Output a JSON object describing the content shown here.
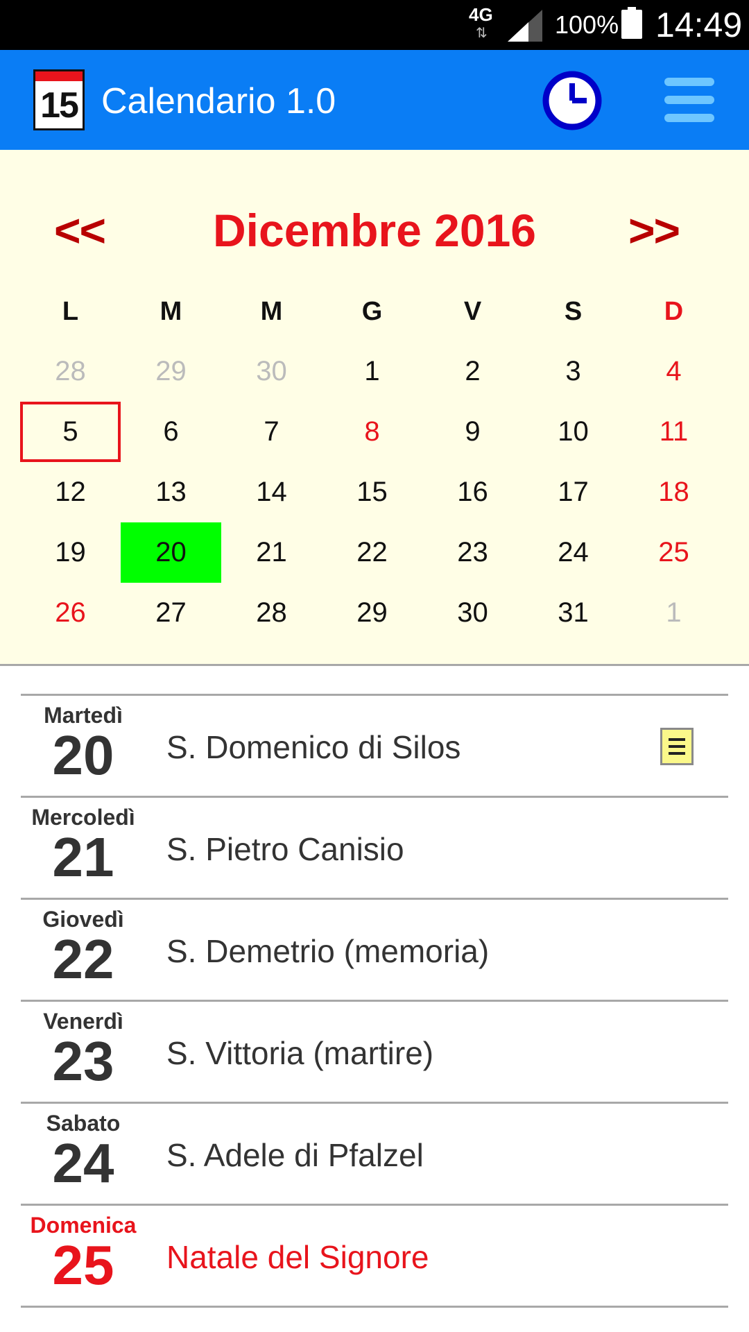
{
  "status_bar": {
    "network": "4G",
    "network_arrows": "⇅",
    "battery": "100%",
    "time": "14:49"
  },
  "app_bar": {
    "icon_number": "15",
    "title": "Calendario 1.0",
    "clock_icon": "clock-icon",
    "menu_icon": "hamburger-menu-icon"
  },
  "calendar": {
    "prev": "<<",
    "next": ">>",
    "month_year": "Dicembre 2016",
    "weekdays": [
      "L",
      "M",
      "M",
      "G",
      "V",
      "S",
      "D"
    ],
    "weeks": [
      [
        "28",
        "29",
        "30",
        "1",
        "2",
        "3",
        "4"
      ],
      [
        "5",
        "6",
        "7",
        "8",
        "9",
        "10",
        "11"
      ],
      [
        "12",
        "13",
        "14",
        "15",
        "16",
        "17",
        "18"
      ],
      [
        "19",
        "20",
        "21",
        "22",
        "23",
        "24",
        "25"
      ],
      [
        "26",
        "27",
        "28",
        "29",
        "30",
        "31",
        "1"
      ]
    ],
    "today": "5",
    "selected": "20",
    "colors": {
      "header": "#0a7df5",
      "background": "#fffee6",
      "holiday": "#e8141c",
      "selected": "#00ff00"
    }
  },
  "days": [
    {
      "weekday": "Martedì",
      "day": "20",
      "saint": "S. Domenico di Silos",
      "has_note": true
    },
    {
      "weekday": "Mercoledì",
      "day": "21",
      "saint": "S. Pietro Canisio",
      "has_note": false
    },
    {
      "weekday": "Giovedì",
      "day": "22",
      "saint": "S. Demetrio (memoria)",
      "has_note": false
    },
    {
      "weekday": "Venerdì",
      "day": "23",
      "saint": "S. Vittoria (martire)",
      "has_note": false
    },
    {
      "weekday": "Sabato",
      "day": "24",
      "saint": "S. Adele di Pfalzel",
      "has_note": false
    },
    {
      "weekday": "Domenica",
      "day": "25",
      "saint": "Natale del Signore",
      "has_note": false
    }
  ]
}
